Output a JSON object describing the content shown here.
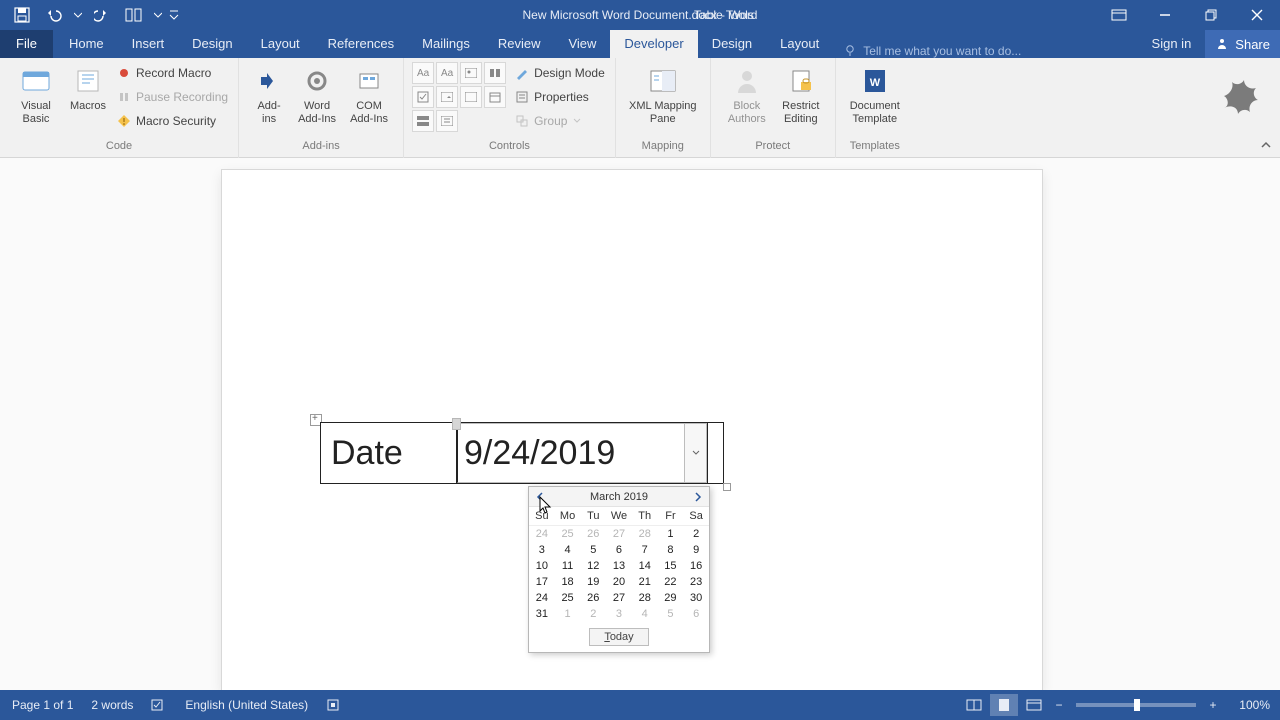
{
  "title": {
    "doc": "New Microsoft Word Document.docx",
    "app": "Word",
    "tabletools": "Table Tools"
  },
  "tabs": {
    "file": "File",
    "list": [
      "Home",
      "Insert",
      "Design",
      "Layout",
      "References",
      "Mailings",
      "Review",
      "View",
      "Developer",
      "Design",
      "Layout"
    ],
    "activeIndex": 8,
    "tellme": "Tell me what you want to do...",
    "signin": "Sign in",
    "share": "Share"
  },
  "ribbon": {
    "code": {
      "label": "Code",
      "visualBasic": "Visual\nBasic",
      "macros": "Macros",
      "record": "Record Macro",
      "pause": "Pause Recording",
      "security": "Macro Security"
    },
    "addins": {
      "label": "Add-ins",
      "addins": "Add-\nins",
      "wordAddins": "Word\nAdd-Ins",
      "comAddins": "COM\nAdd-Ins"
    },
    "controls": {
      "label": "Controls",
      "design": "Design Mode",
      "properties": "Properties",
      "group": "Group"
    },
    "mapping": {
      "label": "Mapping",
      "xml": "XML Mapping\nPane"
    },
    "protect": {
      "label": "Protect",
      "block": "Block\nAuthors",
      "restrict": "Restrict\nEditing"
    },
    "templates": {
      "label": "Templates",
      "doc": "Document\nTemplate"
    }
  },
  "tableContent": {
    "label": "Date",
    "value": "9/24/2019"
  },
  "calendar": {
    "title": "March 2019",
    "today": "Today",
    "dow": [
      "Su",
      "Mo",
      "Tu",
      "We",
      "Th",
      "Fr",
      "Sa"
    ],
    "days": [
      {
        "n": "24",
        "o": true
      },
      {
        "n": "25",
        "o": true
      },
      {
        "n": "26",
        "o": true
      },
      {
        "n": "27",
        "o": true
      },
      {
        "n": "28",
        "o": true
      },
      {
        "n": "1"
      },
      {
        "n": "2"
      },
      {
        "n": "3"
      },
      {
        "n": "4"
      },
      {
        "n": "5"
      },
      {
        "n": "6"
      },
      {
        "n": "7"
      },
      {
        "n": "8"
      },
      {
        "n": "9"
      },
      {
        "n": "10"
      },
      {
        "n": "11"
      },
      {
        "n": "12"
      },
      {
        "n": "13"
      },
      {
        "n": "14"
      },
      {
        "n": "15"
      },
      {
        "n": "16"
      },
      {
        "n": "17"
      },
      {
        "n": "18"
      },
      {
        "n": "19"
      },
      {
        "n": "20"
      },
      {
        "n": "21"
      },
      {
        "n": "22"
      },
      {
        "n": "23"
      },
      {
        "n": "24"
      },
      {
        "n": "25"
      },
      {
        "n": "26"
      },
      {
        "n": "27"
      },
      {
        "n": "28"
      },
      {
        "n": "29"
      },
      {
        "n": "30"
      },
      {
        "n": "31"
      },
      {
        "n": "1",
        "o": true
      },
      {
        "n": "2",
        "o": true
      },
      {
        "n": "3",
        "o": true
      },
      {
        "n": "4",
        "o": true
      },
      {
        "n": "5",
        "o": true
      },
      {
        "n": "6",
        "o": true
      }
    ]
  },
  "status": {
    "page": "Page 1 of 1",
    "words": "2 words",
    "lang": "English (United States)",
    "zoom": "100%"
  }
}
